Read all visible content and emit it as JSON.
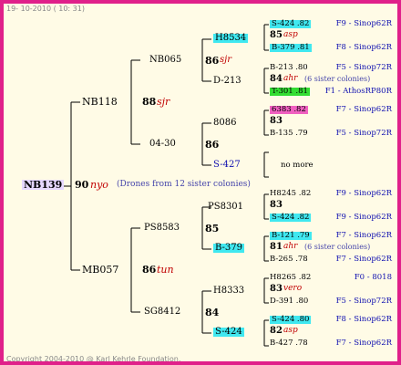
{
  "header": {
    "date": "19- 10-2010 ( 10: 31)"
  },
  "footer": {
    "copyright": "Copyright 2004-2010 @ Karl Kehrle Foundation."
  },
  "root": {
    "id": "NB139",
    "year": "90",
    "breed": "nyo",
    "note": "(Drones from 12 sister colonies)"
  },
  "gen1": [
    {
      "id": "NB118",
      "year": "88",
      "breed": "sjr"
    },
    {
      "id": "MB057",
      "year": "86",
      "breed": "tun"
    }
  ],
  "gen2": [
    {
      "id": "NB065",
      "year": "86",
      "breed": "sjr"
    },
    {
      "id": "04-30",
      "year": "86",
      "breed": ""
    },
    {
      "id": "PS8583",
      "year": "85",
      "breed": ""
    },
    {
      "id": "SG8412",
      "year": "84",
      "breed": ""
    }
  ],
  "gen3": [
    {
      "id": "H8534"
    },
    {
      "id": "D-213"
    },
    {
      "id": "8086"
    },
    {
      "id": "S-427",
      "note": "no more"
    },
    {
      "id": "PS8301"
    },
    {
      "id": "B-379"
    },
    {
      "id": "H8333"
    },
    {
      "id": "S-424"
    }
  ],
  "gen4": [
    {
      "top": "S-424 .82",
      "year": "85",
      "breed": "asp",
      "bottom": "B-379 .81",
      "top_src": "F9 - Sinop62R",
      "bottom_src": "F8 - Sinop62R"
    },
    {
      "top": "B-213 .80",
      "year": "84",
      "breed": "ahr",
      "note": "(6 sister colonies)",
      "bottom": "T-301 .81",
      "top_src": "F5 - Sinop72R",
      "bottom_src": "F1 - AthosRP80R"
    },
    {
      "top": "6383 .82",
      "year": "83",
      "breed": "",
      "bottom": "B-135 .79",
      "top_src": "F7 - Sinop62R",
      "bottom_src": "F5 - Sinop72R"
    },
    {
      "top": "H8245 .82",
      "year": "83",
      "breed": "",
      "bottom": "S-424 .82",
      "top_src": "F9 - Sinop62R",
      "bottom_src": "F9 - Sinop62R"
    },
    {
      "top": "B-121 .79",
      "year": "81",
      "breed": "ahr",
      "note": "(6 sister colonies)",
      "bottom": "B-265 .78",
      "top_src": "F7 - Sinop62R",
      "bottom_src": "F7 - Sinop62R"
    },
    {
      "top": "H8265 .82",
      "year": "83",
      "breed": "vero",
      "bottom": "D-391 .80",
      "top_src": "F0 - 8018",
      "bottom_src": "F5 - Sinop72R"
    },
    {
      "top": "S-424 .80",
      "year": "82",
      "breed": "asp",
      "bottom": "B-427 .78",
      "top_src": "F8 - Sinop62R",
      "bottom_src": "F7 - Sinop62R"
    }
  ]
}
